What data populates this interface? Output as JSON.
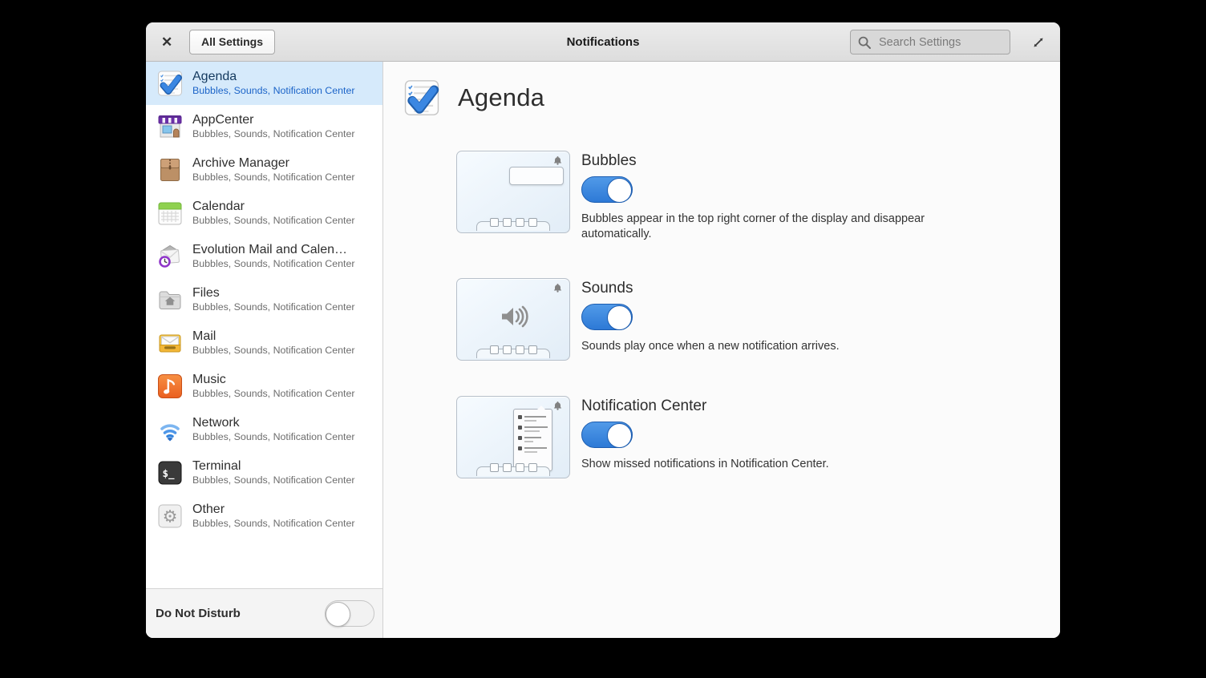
{
  "window": {
    "title": "Notifications"
  },
  "header": {
    "close_glyph": "✕",
    "all_settings_label": "All Settings",
    "search_placeholder": "Search Settings",
    "icons": {
      "close": "close-icon",
      "search": "search-icon",
      "expand": "resize-diagonal-icon"
    }
  },
  "sidebar": {
    "items": [
      {
        "name": "Agenda",
        "subtitle": "Bubbles, Sounds, Notification Center",
        "icon": "agenda",
        "selected": true
      },
      {
        "name": "AppCenter",
        "subtitle": "Bubbles, Sounds, Notification Center",
        "icon": "appcenter",
        "selected": false
      },
      {
        "name": "Archive Manager",
        "subtitle": "Bubbles, Sounds, Notification Center",
        "icon": "archive",
        "selected": false
      },
      {
        "name": "Calendar",
        "subtitle": "Bubbles, Sounds, Notification Center",
        "icon": "calendar",
        "selected": false
      },
      {
        "name": "Evolution Mail and Calen…",
        "subtitle": "Bubbles, Sounds, Notification Center",
        "icon": "evolution",
        "selected": false
      },
      {
        "name": "Files",
        "subtitle": "Bubbles, Sounds, Notification Center",
        "icon": "files",
        "selected": false
      },
      {
        "name": "Mail",
        "subtitle": "Bubbles, Sounds, Notification Center",
        "icon": "mail",
        "selected": false
      },
      {
        "name": "Music",
        "subtitle": "Bubbles, Sounds, Notification Center",
        "icon": "music",
        "selected": false
      },
      {
        "name": "Network",
        "subtitle": "Bubbles, Sounds, Notification Center",
        "icon": "network",
        "selected": false
      },
      {
        "name": "Terminal",
        "subtitle": "Bubbles, Sounds, Notification Center",
        "icon": "terminal",
        "selected": false
      },
      {
        "name": "Other",
        "subtitle": "Bubbles, Sounds, Notification Center",
        "icon": "other",
        "selected": false
      }
    ],
    "do_not_disturb": {
      "label": "Do Not Disturb",
      "enabled": false
    }
  },
  "main": {
    "app_title": "Agenda",
    "app_icon": "agenda",
    "sections": [
      {
        "title": "Bubbles",
        "enabled": true,
        "illustration": "bubble",
        "description": "Bubbles appear in the top right corner of the display and disappear automatically."
      },
      {
        "title": "Sounds",
        "enabled": true,
        "illustration": "sound",
        "description": "Sounds play once when a new notification arrives."
      },
      {
        "title": "Notification Center",
        "enabled": true,
        "illustration": "list",
        "description": "Show missed notifications in Notification Center."
      }
    ]
  },
  "colors": {
    "accent": "#3689e6",
    "selection_bg": "#d6eafb",
    "header_bg": "#e4e4e4",
    "toggle_border": "#1b5cb0"
  }
}
